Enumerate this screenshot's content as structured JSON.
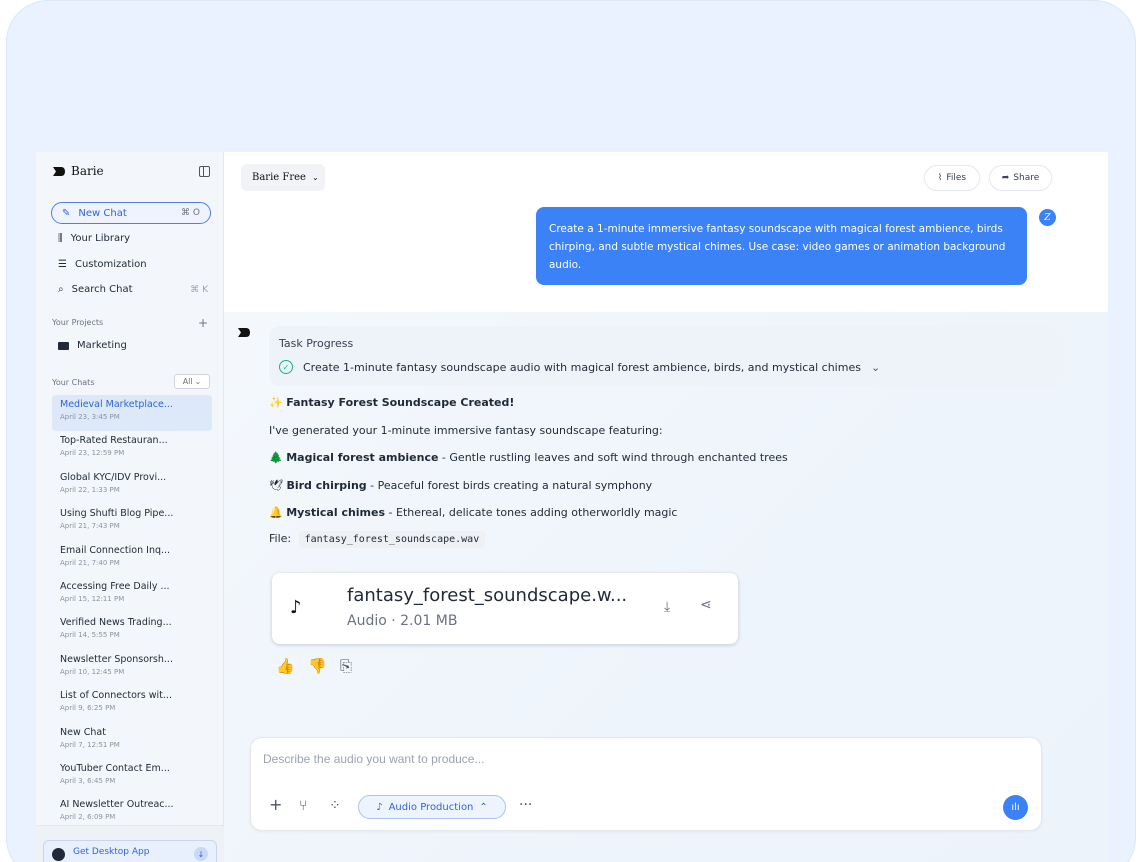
{
  "sidebar": {
    "brand": "Barie",
    "new_chat": {
      "label": "New Chat",
      "shortcut": "⌘ O"
    },
    "nav": [
      {
        "label": "Your Library",
        "icon": "library-icon"
      },
      {
        "label": "Customization",
        "icon": "sliders-icon"
      },
      {
        "label": "Search Chat",
        "icon": "search-icon",
        "shortcut": "⌘ K"
      }
    ],
    "projects_label": "Your Projects",
    "projects": [
      {
        "label": "Marketing",
        "icon": "folder-icon"
      }
    ],
    "chats_label": "Your Chats",
    "chats_filter": "All",
    "chats": [
      {
        "title": "Medieval Marketplace...",
        "date": "April 23, 3:45 PM",
        "active": true
      },
      {
        "title": "Top-Rated Restauran...",
        "date": "April 23, 12:59 PM"
      },
      {
        "title": "Global KYC/IDV Provi...",
        "date": "April 22, 1:33 PM"
      },
      {
        "title": "Using Shufti Blog Pipe...",
        "date": "April 21, 7:43 PM"
      },
      {
        "title": "Email Connection Inq...",
        "date": "April 21, 7:40 PM"
      },
      {
        "title": "Accessing Free Daily ...",
        "date": "April 15, 12:11 PM"
      },
      {
        "title": "Verified News Trading...",
        "date": "April 14, 5:55 PM"
      },
      {
        "title": "Newsletter Sponsorsh...",
        "date": "April 10, 12:45 PM"
      },
      {
        "title": "List of Connectors wit...",
        "date": "April 9, 6:25 PM"
      },
      {
        "title": "New Chat",
        "date": "April 7, 12:51 PM"
      },
      {
        "title": "YouTuber Contact Em...",
        "date": "April 3, 6:45 PM"
      },
      {
        "title": "AI Newsletter Outreac...",
        "date": "April 2, 6:09 PM"
      }
    ],
    "desktop_app": "Get Desktop App"
  },
  "header": {
    "model": "Barie Free",
    "files": "Files",
    "share": "Share"
  },
  "conversation": {
    "user_message": "Create a 1-minute immersive fantasy soundscape with magical forest ambience, birds chirping, and subtle mystical chimes. Use case: video games or animation background audio.",
    "user_avatar": "Z",
    "task_progress_title": "Task Progress",
    "task_step": "Create 1-minute fantasy soundscape audio with magical forest ambience, birds, and mystical chimes",
    "heading": "Fantasy Forest Soundscape Created!",
    "intro": "I've generated your 1-minute immersive fantasy soundscape featuring:",
    "features": [
      {
        "emoji": "🌲",
        "title": "Magical forest ambience",
        "desc": " - Gentle rustling leaves and soft wind through enchanted trees"
      },
      {
        "emoji": "🕊",
        "title": "Bird chirping",
        "desc": " - Peaceful forest birds creating a natural symphony"
      },
      {
        "emoji": "🔔",
        "title": "Mystical chimes",
        "desc": " - Ethereal, delicate tones adding otherworldly magic"
      }
    ],
    "file_label": "File:",
    "file_name": "fantasy_forest_soundscape.wav",
    "audio_card": {
      "name": "fantasy_forest_soundscape.w...",
      "meta": "Audio · 2.01 MB"
    }
  },
  "composer": {
    "placeholder": "Describe the audio you want to produce...",
    "mode": "Audio Production",
    "more": "···"
  }
}
